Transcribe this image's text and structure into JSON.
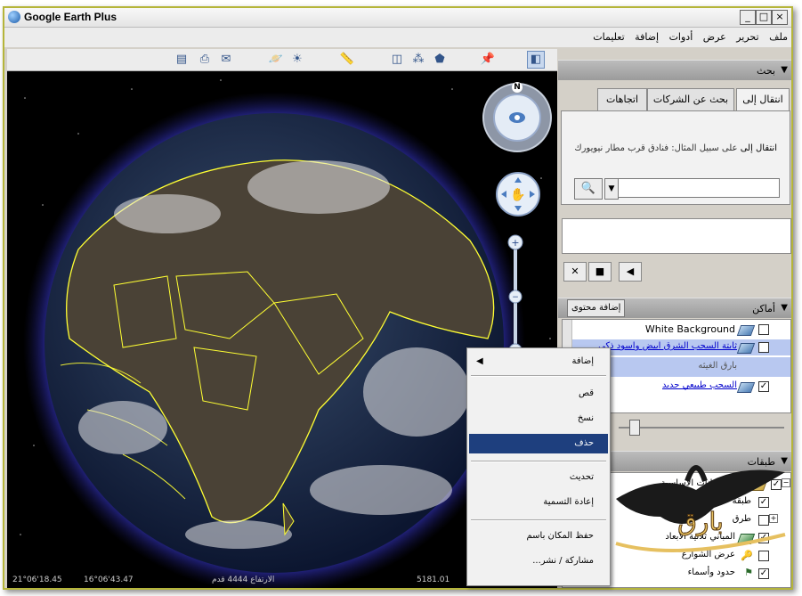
{
  "window": {
    "title": "Google Earth Plus",
    "minimize": "_",
    "maximize": "□",
    "close": "×"
  },
  "menu": [
    "ملف",
    "تحرير",
    "عرض",
    "أدوات",
    "إضافة",
    "تعليمات"
  ],
  "toolbar_icons": [
    "print-icon",
    "print-icon",
    "email-icon",
    "planet-icon",
    "sunlight-icon",
    "ruler-icon",
    "add-overlay-icon",
    "add-path-icon",
    "add-polygon-icon",
    "add-placemark-icon",
    "sidebar-toggle-icon"
  ],
  "search": {
    "header": "بحث",
    "tabs": [
      "انتقال إلى",
      "بحث عن الشركات",
      "اتجاهات"
    ],
    "goto_label": "انتقال إلى",
    "example": "على سبيل المثال: فنادق قرب مطار نيويورك",
    "input_value": ""
  },
  "places": {
    "header": "أماكن",
    "add_content": "إضافة محتوى",
    "items": [
      {
        "label": "White Background",
        "checked": false,
        "link": false,
        "selected": false
      },
      {
        "label": "ثابتة السحب الشرق ابيض واسود ذكي",
        "checked": false,
        "link": true,
        "selected": true
      },
      {
        "label": "بارق الغيثه",
        "checked": false,
        "link": false,
        "selected": true
      },
      {
        "label": "السحب طبيعي جديد",
        "checked": true,
        "link": true,
        "selected": false
      }
    ]
  },
  "layers": {
    "header": "طبقات",
    "items": [
      {
        "label": "قاعدة البيانات الأساسية",
        "checked": true
      },
      {
        "label": "طبقة",
        "checked": true
      },
      {
        "label": "طرق",
        "checked": false
      },
      {
        "label": "المباني ثلاثية الأبعاد",
        "checked": true
      },
      {
        "label": "عرض الشوارع",
        "checked": false
      },
      {
        "label": "حدود وأسماء",
        "checked": true
      }
    ]
  },
  "context_menu": {
    "items": [
      {
        "label": "إضافة",
        "submenu": true,
        "selected": false
      },
      {
        "label": "قص",
        "selected": false
      },
      {
        "label": "نسخ",
        "selected": false
      },
      {
        "label": "حذف",
        "selected": true
      },
      {
        "label": "تحديث",
        "selected": false
      },
      {
        "label": "إعادة التسمية",
        "selected": false
      },
      {
        "label": "حفظ المكان باسم",
        "selected": false
      },
      {
        "label": "مشاركة / نشر...",
        "selected": false
      }
    ]
  },
  "status": {
    "lat": "21°06'18.45",
    "lon": "16°06'43.47",
    "elev": "الارتفاع 4444 قدم",
    "eye": "5181.01"
  },
  "nav": {
    "north": "N"
  },
  "colors": {
    "highlight": "#b8c8f0",
    "menu_selected": "#1e3f7e",
    "border_yellow": "#ffff33"
  }
}
